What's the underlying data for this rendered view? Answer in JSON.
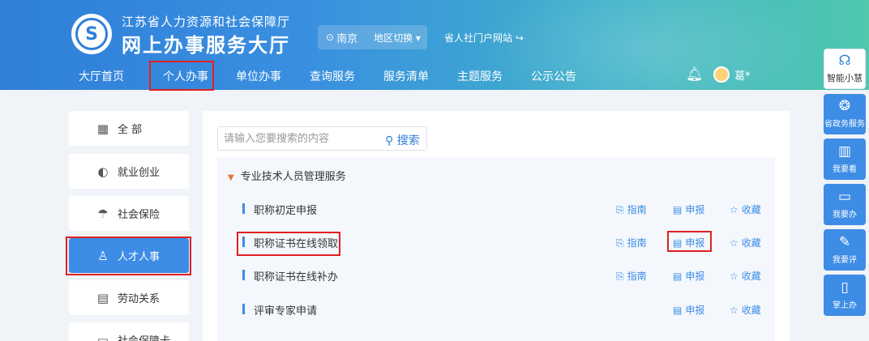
{
  "header": {
    "org_name": "江苏省人力资源和社会保障厅",
    "hall_name": "网上办事服务大厅",
    "location": "南京",
    "region_switch": "地区切换",
    "portal_link": "省人社门户网站",
    "username": "葛*"
  },
  "nav": {
    "items": [
      "大厅首页",
      "个人办事",
      "单位办事",
      "查询服务",
      "服务清单",
      "主题服务",
      "公示公告"
    ]
  },
  "sidebar": {
    "items": [
      {
        "label": "全 部",
        "icon": "grid-icon"
      },
      {
        "label": "就业创业",
        "icon": "employment-icon"
      },
      {
        "label": "社会保险",
        "icon": "umbrella-icon"
      },
      {
        "label": "人才人事",
        "icon": "people-icon"
      },
      {
        "label": "劳动关系",
        "icon": "document-icon"
      },
      {
        "label": "社会保障卡",
        "icon": "card-icon"
      }
    ]
  },
  "search": {
    "placeholder": "请输入您要搜索的内容",
    "button_label": "搜索"
  },
  "category": {
    "title": "专业技术人员管理服务",
    "rows": [
      {
        "name": "职称初定申报",
        "guide": "指南",
        "apply": "申报",
        "favorite": "收藏"
      },
      {
        "name": "职称证书在线领取",
        "guide": "指南",
        "apply": "申报",
        "favorite": "收藏"
      },
      {
        "name": "职称证书在线补办",
        "guide": "指南",
        "apply": "申报",
        "favorite": "收藏"
      },
      {
        "name": "评审专家申请",
        "apply": "申报",
        "favorite": "收藏"
      }
    ]
  },
  "right_toolbar": {
    "items": [
      "智能小慧",
      "省政务服务",
      "我要看",
      "我要办",
      "我要评",
      "掌上办"
    ]
  },
  "colors": {
    "accent": "#3d8ce5",
    "highlight_border": "#e02020",
    "category_arrow": "#e8732d"
  }
}
